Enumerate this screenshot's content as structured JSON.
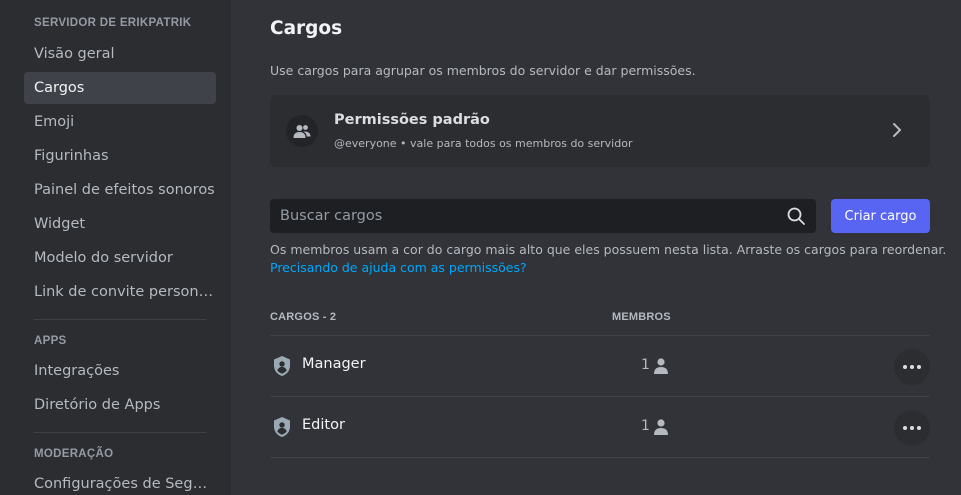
{
  "sidebar": {
    "server_header": "SERVIDOR DE ERIKPATRIK",
    "items": [
      {
        "label": "Visão geral"
      },
      {
        "label": "Cargos"
      },
      {
        "label": "Emoji"
      },
      {
        "label": "Figurinhas"
      },
      {
        "label": "Painel de efeitos sonoros"
      },
      {
        "label": "Widget"
      },
      {
        "label": "Modelo do servidor"
      },
      {
        "label": "Link de convite personalizado"
      }
    ],
    "apps_header": "APPS",
    "apps_items": [
      {
        "label": "Integrações"
      },
      {
        "label": "Diretório de Apps"
      }
    ],
    "moderation_header": "MODERAÇÃO",
    "moderation_items": [
      {
        "label": "Configurações de Segurança"
      }
    ],
    "active_item": "Cargos"
  },
  "main": {
    "title": "Cargos",
    "description": "Use cargos para agrupar os membros do servidor e dar permissões.",
    "default_permissions": {
      "title": "Permissões padrão",
      "subtitle": "@everyone • vale para todos os membros do servidor"
    },
    "search": {
      "placeholder": "Buscar cargos",
      "value": ""
    },
    "create_button": "Criar cargo",
    "help_text": "Os membros usam a cor do cargo mais alto que eles possuem nesta lista. Arraste os cargos para reordenar.",
    "help_link": "Precisando de ajuda com as permissões?",
    "table": {
      "col_roles": "CARGOS - 2",
      "col_members": "MEMBROS",
      "rows": [
        {
          "name": "Manager",
          "members": "1"
        },
        {
          "name": "Editor",
          "members": "1"
        }
      ]
    }
  },
  "colors": {
    "accent": "#5865f2",
    "link": "#00a8fc",
    "background": "#313338",
    "sidebar_background": "#2b2d31"
  },
  "icons": {
    "permissions": "people-icon",
    "chevron": "chevron-right-icon",
    "search": "search-icon",
    "role": "shield-icon",
    "members": "person-icon",
    "more": "more-dots-icon"
  }
}
